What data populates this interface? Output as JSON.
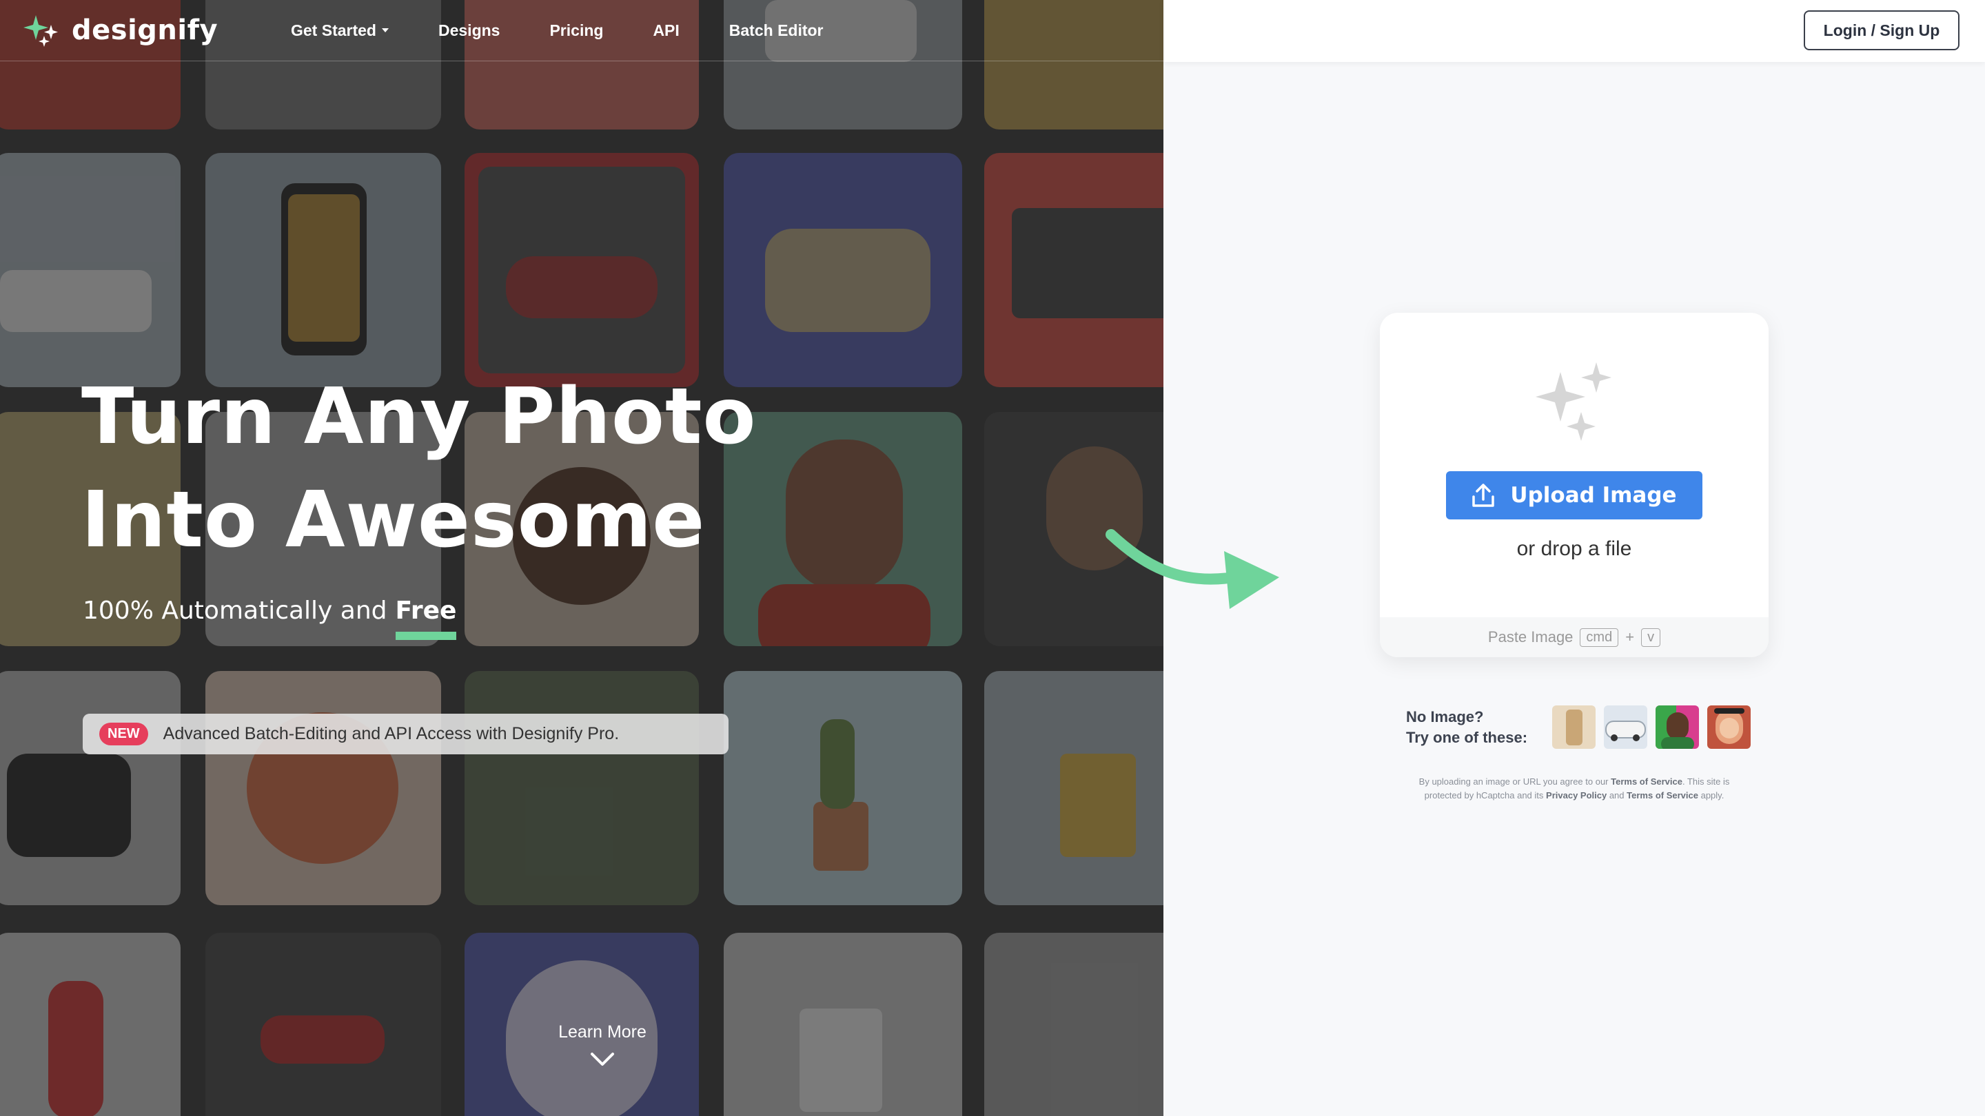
{
  "brand": {
    "name": "designify"
  },
  "nav": {
    "items": [
      {
        "label": "Get Started",
        "has_dropdown": true
      },
      {
        "label": "Designs"
      },
      {
        "label": "Pricing"
      },
      {
        "label": "API"
      },
      {
        "label": "Batch Editor"
      }
    ],
    "login_label": "Login / Sign Up"
  },
  "hero": {
    "headline_line1": "Turn Any Photo",
    "headline_line2": "Into Awesome",
    "sub_prefix": "100% Automatically and",
    "sub_highlight": "Free",
    "promo_badge": "NEW",
    "promo_text": "Advanced Batch-Editing and API Access with Designify Pro.",
    "learn_more": "Learn More"
  },
  "upload": {
    "button_label": "Upload Image",
    "drop_text": "or drop a file",
    "paste_label": "Paste Image",
    "key_cmd": "cmd",
    "key_plus": "+",
    "key_v": "v"
  },
  "samples": {
    "label_line1": "No Image?",
    "label_line2": "Try one of these:",
    "items": [
      "sample-product-icon",
      "sample-car-icon",
      "sample-man-icon",
      "sample-woman-icon"
    ]
  },
  "legal": {
    "part1": "By uploading an image or URL you agree to our",
    "tos": "Terms of Service",
    "part2": ". This site is protected by hCaptcha and its",
    "privacy": "Privacy Policy",
    "part3": "and",
    "tos2": "Terms of Service",
    "part4": "apply."
  },
  "colors": {
    "accent_green": "#6fd49b",
    "upload_blue": "#3f86ea",
    "badge_red": "#e63e5c"
  }
}
